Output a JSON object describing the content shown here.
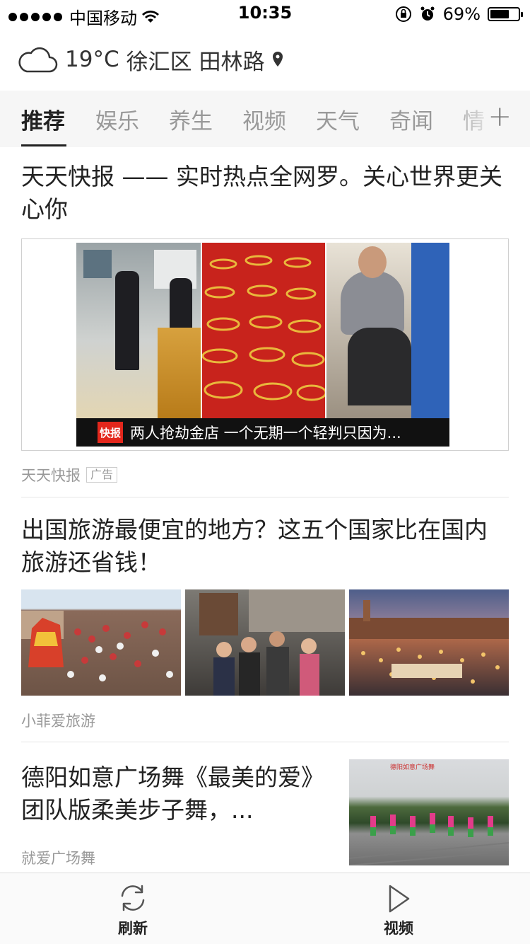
{
  "status_bar": {
    "carrier": "中国移动",
    "time": "10:35",
    "battery": "69%",
    "battery_level": 0.69,
    "signal_bars": 5
  },
  "weather": {
    "temperature": "19°C",
    "location": "徐汇区 田林路",
    "icon": "cloud-icon"
  },
  "tabs": [
    {
      "label": "推荐",
      "active": true
    },
    {
      "label": "娱乐",
      "active": false
    },
    {
      "label": "养生",
      "active": false
    },
    {
      "label": "视频",
      "active": false
    },
    {
      "label": "天气",
      "active": false
    },
    {
      "label": "奇闻",
      "active": false
    },
    {
      "label": "情",
      "active": false
    }
  ],
  "tabs_add_icon": "plus-icon",
  "feed": [
    {
      "title": "天天快报 —— 实时热点全网罗。关心世界更关心你",
      "image_caption": "两人抢劫金店 一个无期一个轻判只因为...",
      "caption_logo": "快报",
      "source": "天天快报",
      "tag": "广告"
    },
    {
      "title": "出国旅游最便宜的地方？这五个国家比在国内旅游还省钱！",
      "source": "小菲爱旅游"
    },
    {
      "title": "德阳如意广场舞《最美的爱》团队版柔美步子舞，...",
      "source": "就爱广场舞",
      "thumb_banner": "德阳如意广场舞"
    }
  ],
  "bottom_nav": {
    "refresh_label": "刷新",
    "video_label": "视频"
  }
}
